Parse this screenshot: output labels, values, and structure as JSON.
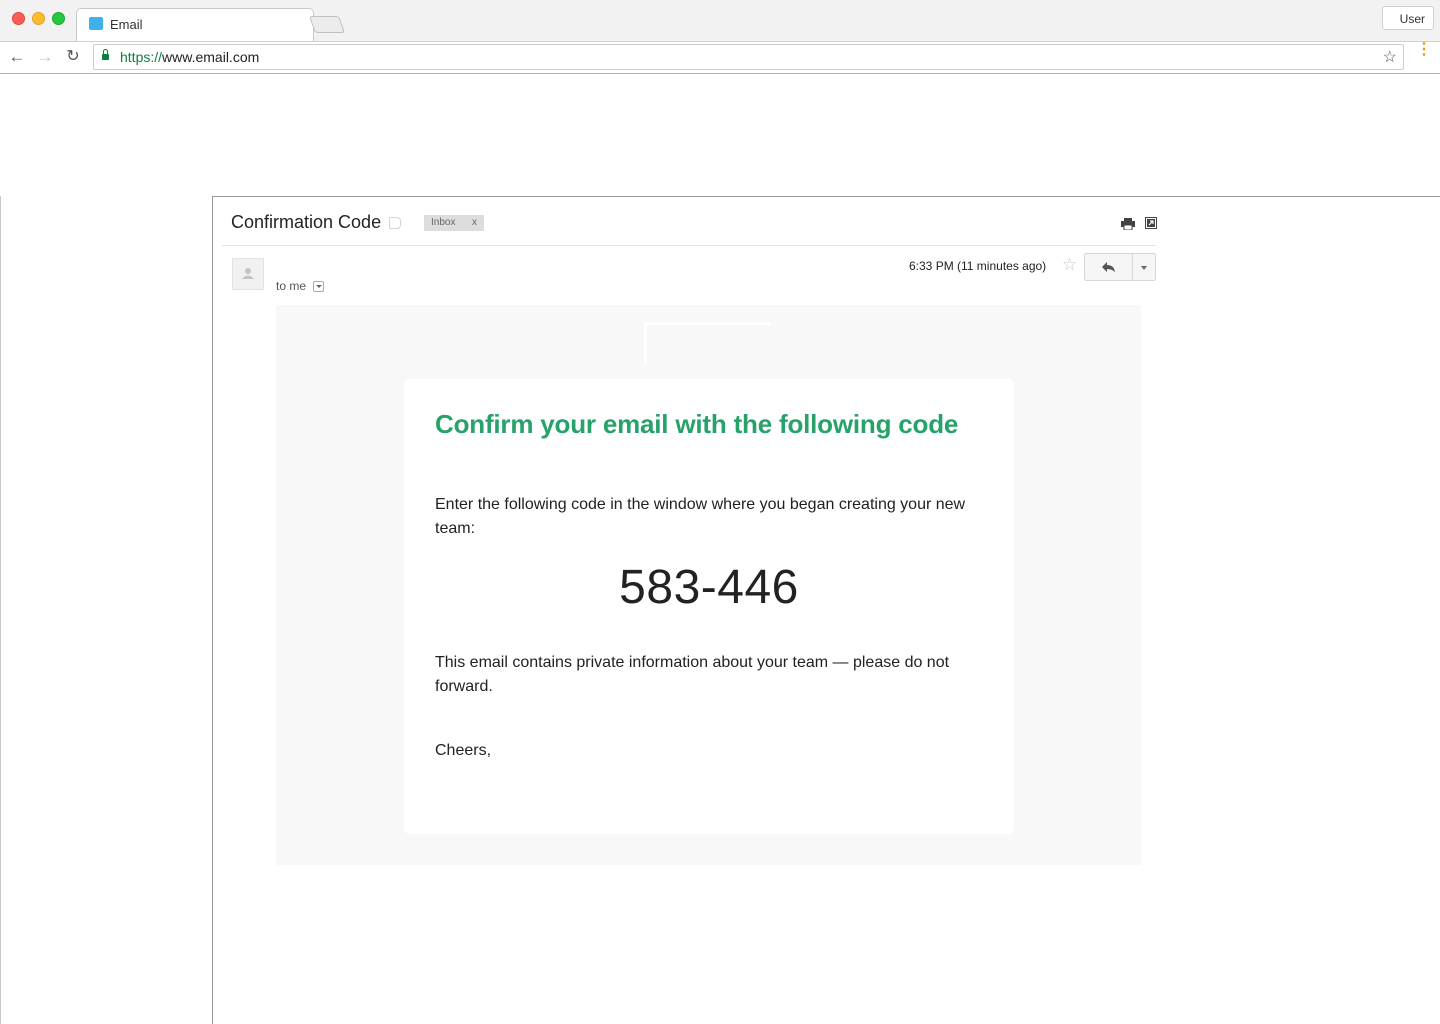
{
  "browser": {
    "tab_title": "Email",
    "user_button": "User",
    "url_scheme": "https://",
    "url_host": "www.email.com",
    "icons": {
      "back": "arrow-left-icon",
      "forward": "arrow-right-icon",
      "reload": "reload-icon",
      "lock": "lock-icon",
      "bookmark": "star-icon",
      "menu": "kebab-menu-icon"
    },
    "accent_colors": {
      "secure": "#0b8043",
      "menu": "#f29900",
      "favicon": "#3fb2ee"
    }
  },
  "message": {
    "subject": "Confirmation Code",
    "label_chip": "Inbox",
    "label_chip_remove": "x",
    "recipient": "to me",
    "timestamp": "6:33 PM (11 minutes ago)",
    "icons": {
      "print": "print-icon",
      "new_window": "popout-icon",
      "star": "star-icon",
      "reply": "reply-icon",
      "more": "chevron-down-icon",
      "avatar": "person-icon"
    }
  },
  "email_body": {
    "heading": "Confirm your email with the following code",
    "instruction": "Enter the following code in the window where you began creating your new team:",
    "code": "583-446",
    "warning": "This email contains private information about your team — please do not forward.",
    "signoff": "Cheers,",
    "heading_color": "#26a26a"
  }
}
